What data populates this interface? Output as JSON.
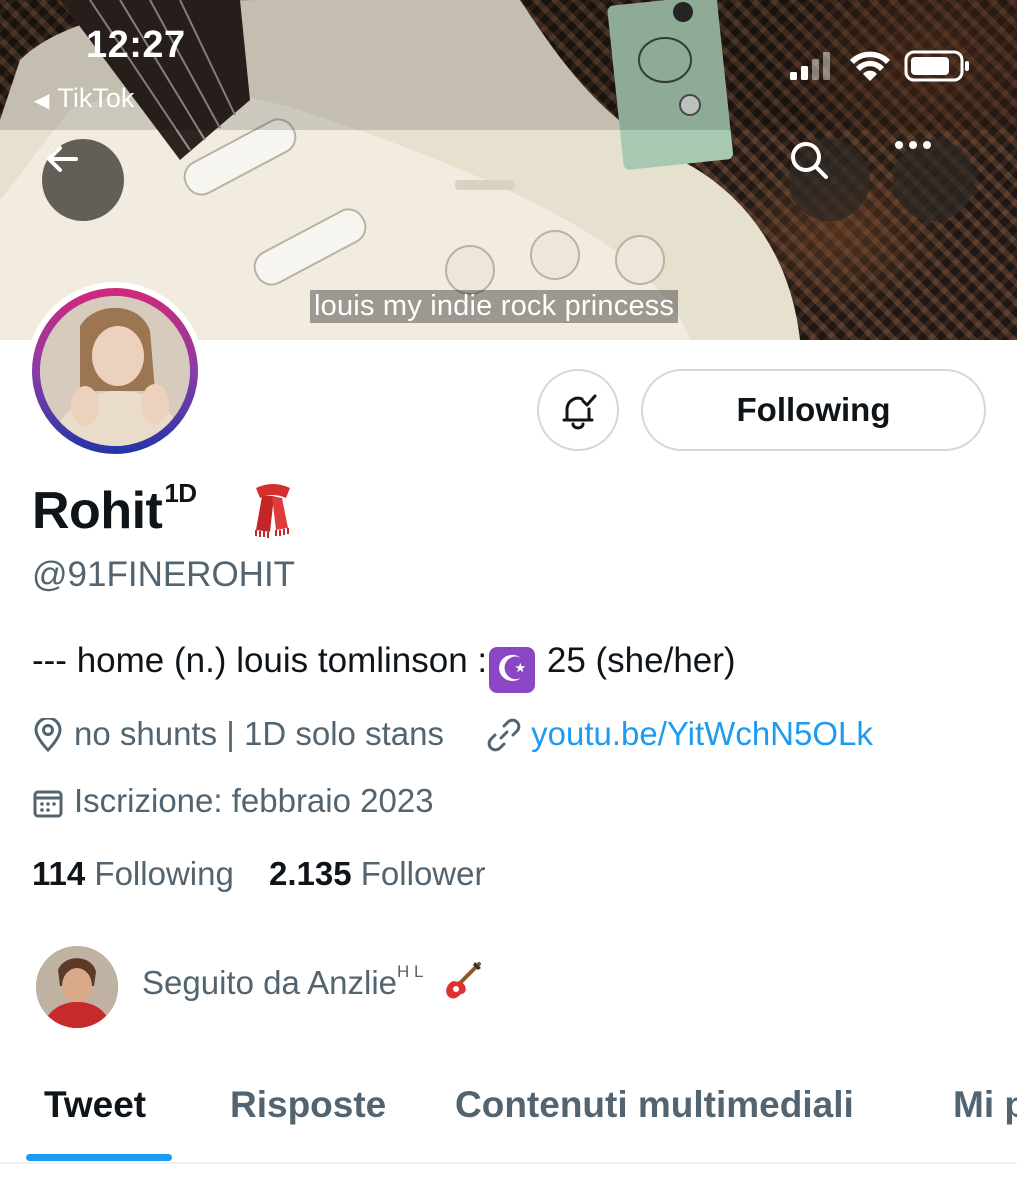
{
  "status_bar": {
    "time": "12:27",
    "back_app_label": "TikTok",
    "signal_icon": "cellular-signal-icon",
    "wifi_icon": "wifi-icon",
    "battery_icon": "battery-icon"
  },
  "banner": {
    "caption": "louis my indie rock princess",
    "back_icon": "arrow-left-icon",
    "search_icon": "search-icon",
    "more_icon": "more-horizontal-icon"
  },
  "actions": {
    "notify_icon": "bell-check-icon",
    "following_label": "Following"
  },
  "profile": {
    "name": "Rohit",
    "name_superscript": "1D",
    "name_emoji": "🧣",
    "handle": "@91FINEROHIT",
    "bio_prefix": "--- home (n.) louis tomlinson :",
    "bio_emoji": "☪",
    "bio_suffix": " 25 (she/her)",
    "location": "no shunts | 1D solo stans",
    "website": "youtu.be/YitWchN5OLk",
    "joined": "Iscrizione: febbraio 2023"
  },
  "stats": {
    "following_count": "114",
    "following_label": "Following",
    "follower_count": "2.135",
    "follower_label": "Follower"
  },
  "followed_by": {
    "text": "Seguito da Anzlie",
    "superscript": "H L",
    "emoji": "🎸"
  },
  "tabs": [
    "Tweet",
    "Risposte",
    "Contenuti multimediali",
    "Mi p"
  ],
  "colors": {
    "accent": "#1d9bf0",
    "text_primary": "#0f1419",
    "text_secondary": "#536471",
    "border": "#cfd9de"
  }
}
